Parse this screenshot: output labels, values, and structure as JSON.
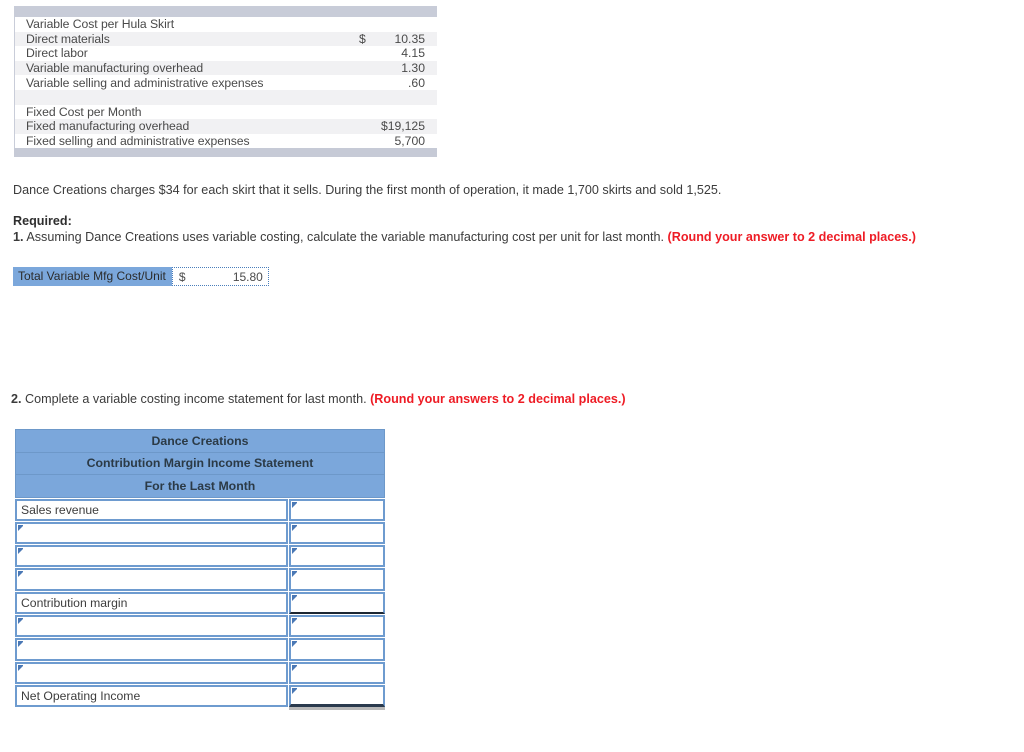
{
  "cost_table": {
    "rows": [
      {
        "label": "Variable Cost per Hula Skirt",
        "currency": "",
        "value": ""
      },
      {
        "label": "Direct materials",
        "currency": "$",
        "value": "10.35"
      },
      {
        "label": "Direct labor",
        "currency": "",
        "value": "4.15"
      },
      {
        "label": "Variable manufacturing overhead",
        "currency": "",
        "value": "1.30"
      },
      {
        "label": "Variable selling and administrative expenses",
        "currency": "",
        "value": ".60"
      },
      {
        "label": "",
        "currency": "",
        "value": ""
      },
      {
        "label": "Fixed Cost per Month",
        "currency": "",
        "value": ""
      },
      {
        "label": "Fixed manufacturing overhead",
        "currency": "",
        "value": "$19,125"
      },
      {
        "label": "Fixed selling and administrative expenses",
        "currency": "",
        "value": "5,700"
      }
    ]
  },
  "narrative": {
    "text": "Dance Creations charges $34 for each skirt that it sells. During the first month of operation, it made 1,700 skirts and sold 1,525."
  },
  "required": {
    "heading": "Required:",
    "q1_number": "1.",
    "q1_text": " Assuming Dance Creations uses variable costing, calculate the variable manufacturing cost per unit for last month. ",
    "q1_note": "(Round your answer to 2 decimal places.)",
    "q2_number": "2.",
    "q2_text": " Complete a variable costing income statement for last month. ",
    "q2_note": "(Round your answers to 2 decimal places.)"
  },
  "answer1": {
    "label": "Total Variable Mfg Cost/Unit",
    "currency": "$",
    "value": "15.80"
  },
  "income_statement": {
    "header_lines": [
      "Dance Creations",
      "Contribution Margin Income Statement",
      "For the Last Month"
    ],
    "rows": [
      {
        "label": "Sales revenue",
        "value": "",
        "label_marker": false,
        "value_marker": true,
        "value_underline": false,
        "value_final": false
      },
      {
        "label": "",
        "value": "",
        "label_marker": true,
        "value_marker": true,
        "value_underline": false,
        "value_final": false
      },
      {
        "label": "",
        "value": "",
        "label_marker": true,
        "value_marker": true,
        "value_underline": false,
        "value_final": false
      },
      {
        "label": "",
        "value": "",
        "label_marker": true,
        "value_marker": true,
        "value_underline": false,
        "value_final": false
      },
      {
        "label": "Contribution margin",
        "value": "",
        "label_marker": false,
        "value_marker": true,
        "value_underline": true,
        "value_final": false
      },
      {
        "label": "",
        "value": "",
        "label_marker": true,
        "value_marker": true,
        "value_underline": false,
        "value_final": false
      },
      {
        "label": "",
        "value": "",
        "label_marker": true,
        "value_marker": true,
        "value_underline": false,
        "value_final": false
      },
      {
        "label": "",
        "value": "",
        "label_marker": true,
        "value_marker": true,
        "value_underline": false,
        "value_final": false
      },
      {
        "label": "Net Operating Income",
        "value": "",
        "label_marker": false,
        "value_marker": true,
        "value_underline": false,
        "value_final": true
      }
    ]
  },
  "colors": {
    "header_blue": "#7ba7db",
    "cell_border_blue": "#6e9bcf",
    "band_gray": "#c8ccd8",
    "alt_row": "#f1f1f3",
    "red_note": "#ee1c25"
  }
}
